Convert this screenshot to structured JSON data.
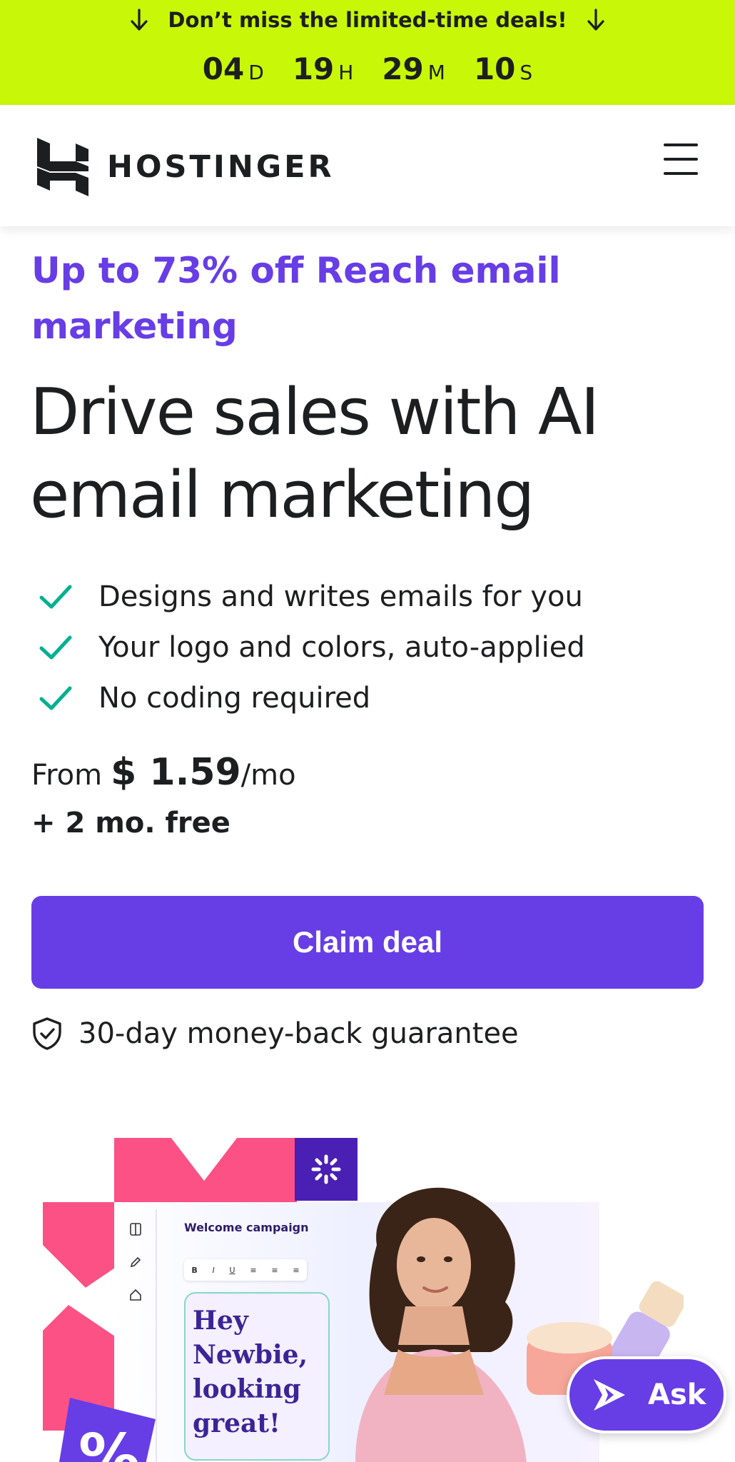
{
  "promo": {
    "text": "Don’t miss the limited-time deals!",
    "countdown": [
      {
        "value": "04",
        "unit": "D"
      },
      {
        "value": "19",
        "unit": "H"
      },
      {
        "value": "29",
        "unit": "M"
      },
      {
        "value": "10",
        "unit": "S"
      }
    ]
  },
  "header": {
    "logo_text": "HOSTINGER"
  },
  "main": {
    "eyebrow": "Up to 73% off Reach email marketing",
    "headline": "Drive sales with AI email marketing",
    "features": [
      "Designs and writes emails for you",
      "Your logo and colors, auto-applied",
      "No coding required"
    ],
    "price": {
      "from": "From",
      "amount": "$ 1.59",
      "period": "/mo",
      "bonus": "+ 2 mo. free"
    },
    "cta_label": "Claim deal",
    "guarantee": "30-day money-back guarantee"
  },
  "hero": {
    "campaign_title": "Welcome campaign",
    "toolbar_buttons": [
      "B",
      "I",
      "U",
      "≡",
      "≡",
      "≡"
    ],
    "card_text": "Hey Newbie, looking great!",
    "percent_glyph": "%"
  },
  "ask_button": {
    "label": "Ask"
  },
  "colors": {
    "promo_bg": "#c9f708",
    "brand_purple": "#673de6",
    "check_green": "#00b090",
    "pink": "#fc5185"
  },
  "icons": [
    "arrow-down-icon",
    "hostinger-logo-icon",
    "menu-icon",
    "check-icon",
    "shield-check-icon",
    "ai-sparkle-icon"
  ]
}
